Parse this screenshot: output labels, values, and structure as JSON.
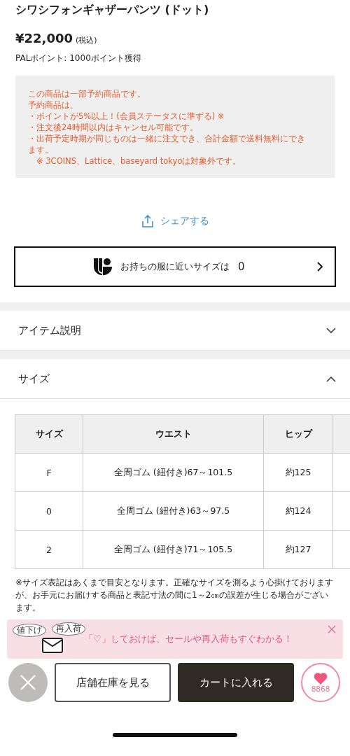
{
  "product": {
    "title": "シワシフォンギャザーパンツ (ドット)",
    "price": "¥22,000",
    "tax_note": "(税込)",
    "points": "PALポイント: 1000ポイント獲得"
  },
  "notice": {
    "lines": [
      "この商品は一部予約商品です。",
      "予約商品は、",
      "・ポイントが5%以上！(会員ステータスに準ずる) ※",
      "・注文後24時間以内はキャンセル可能です。",
      "・出荷予定時期が同じものは一緒に注文でき、合計金額で送料無料にできます。",
      "　※ 3COINS、Lattice、baseyard tokyoは対象外です。"
    ]
  },
  "share": {
    "label": "シェアする"
  },
  "size_finder": {
    "label": "お持ちの服に近いサイズは",
    "count": "0"
  },
  "sections": [
    {
      "title": "アイテム説明",
      "expanded": false
    },
    {
      "title": "サイズ",
      "expanded": true
    }
  ],
  "size_table": {
    "columns": [
      "サイズ",
      "ウエスト",
      "ヒップ"
    ],
    "rows": [
      [
        "F",
        "全周ゴム (紐付き)67～101.5",
        "約125"
      ],
      [
        "0",
        "全周ゴム (紐付き)63～97.5",
        "約124"
      ],
      [
        "2",
        "全周ゴム (紐付き)71～105.5",
        "約127"
      ]
    ]
  },
  "size_note": "※サイズ表記はあくまで目安となります。正確なサイズを測るよう心掛けておりますが、お手元にお届けする商品と表記寸法の間に1～2㎝の誤差が生じる場合がございます。",
  "favorite_banner": {
    "bubbles": [
      "値下げ",
      "再入荷"
    ],
    "message": "「♡」しておけば、セールや再入荷もすぐわかる！"
  },
  "bottom_bar": {
    "store_stock": "店舗在庫を見る",
    "add_to_cart": "カートに入れる",
    "favorites": "8868"
  }
}
